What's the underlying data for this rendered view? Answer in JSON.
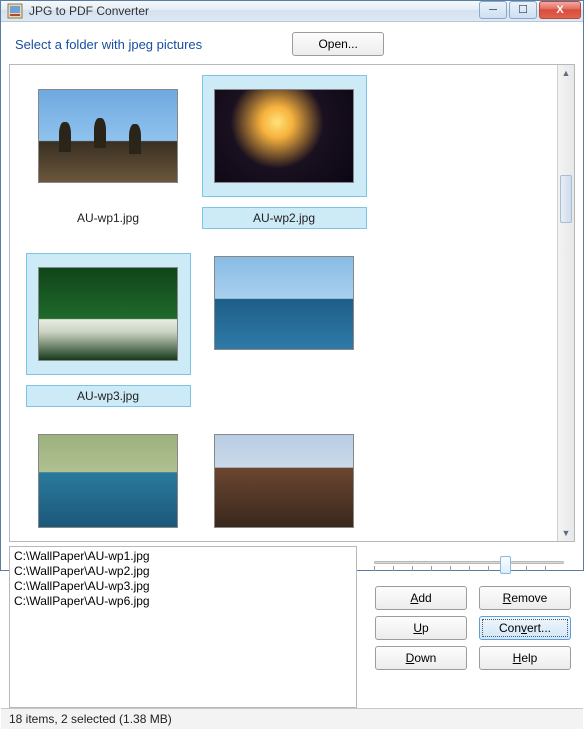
{
  "window": {
    "title": "JPG to PDF Converter"
  },
  "instruction": "Select a folder with jpeg pictures",
  "buttons": {
    "open": "Open...",
    "add": "Add",
    "remove": "Remove",
    "up": "Up",
    "convert": "Convert...",
    "down": "Down",
    "help": "Help"
  },
  "thumbs": [
    {
      "label": "AU-wp1.jpg",
      "selected": false
    },
    {
      "label": "AU-wp2.jpg",
      "selected": true
    },
    {
      "label": "AU-wp3.jpg",
      "selected": true
    },
    {
      "label": "",
      "selected": false
    },
    {
      "label": "",
      "selected": false
    },
    {
      "label": "",
      "selected": false
    }
  ],
  "list": [
    "C:\\WallPaper\\AU-wp1.jpg",
    "C:\\WallPaper\\AU-wp2.jpg",
    "C:\\WallPaper\\AU-wp3.jpg",
    "C:\\WallPaper\\AU-wp6.jpg"
  ],
  "status": "18 items, 2 selected (1.38 MB)"
}
